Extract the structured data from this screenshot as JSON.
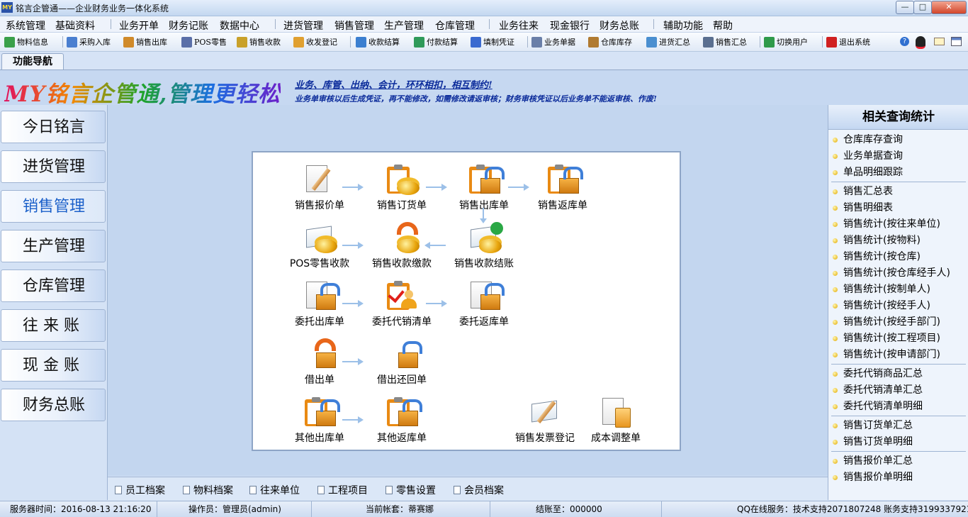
{
  "window": {
    "title": "铭言企管通——企业财务业务一体化系统",
    "logo_text": "MY",
    "controls": {
      "minimize": "—",
      "maximize": "□",
      "close": "✕"
    }
  },
  "menu": [
    "系统管理",
    "基础资料",
    "业务开单",
    "财务记账",
    "数据中心",
    "进货管理",
    "销售管理",
    "生产管理",
    "仓库管理",
    "业务往来",
    "现金银行",
    "财务总账",
    "辅助功能",
    "帮助"
  ],
  "toolbar": [
    {
      "label": "物料信息",
      "icon": "materials-icon",
      "color": "#3aa04a"
    },
    {
      "label": "采购入库",
      "icon": "purchase-in-icon",
      "color": "#4a7fd0"
    },
    {
      "label": "销售出库",
      "icon": "sales-out-icon",
      "color": "#d08a2a"
    },
    {
      "label": "POS零售",
      "icon": "pos-icon",
      "color": "#5a6fa8"
    },
    {
      "label": "销售收款",
      "icon": "sales-receipt-icon",
      "color": "#c9a12a"
    },
    {
      "label": "收发登记",
      "icon": "dispatch-register-icon",
      "color": "#e0a030"
    },
    {
      "label": "收款结算",
      "icon": "receipt-settle-icon",
      "color": "#3b7fd0"
    },
    {
      "label": "付款结算",
      "icon": "payment-settle-icon",
      "color": "#2f9a5a"
    },
    {
      "label": "填制凭证",
      "icon": "voucher-icon",
      "color": "#3a6ad0"
    },
    {
      "label": "业务单据",
      "icon": "documents-icon",
      "color": "#6a7fa8"
    },
    {
      "label": "仓库库存",
      "icon": "warehouse-icon",
      "color": "#b07a30"
    },
    {
      "label": "进货汇总",
      "icon": "purchase-summary-icon",
      "color": "#4a8fd0"
    },
    {
      "label": "销售汇总",
      "icon": "sales-summary-icon",
      "color": "#5a6f90"
    },
    {
      "label": "切换用户",
      "icon": "switch-user-icon",
      "color": "#2f9a4a"
    },
    {
      "label": "退出系统",
      "icon": "power-icon",
      "color": "#d02020"
    }
  ],
  "nav_tab": "功能导航",
  "banner": {
    "main": "MY铭言企管通,管理更轻松",
    "line1": "业务、库管、出纳、会计，环环相扣，相互制约!",
    "line2": "业务单审核以后生成凭证，再不能修改，如需修改请返审核；财务审核凭证以后业务单不能返审核、作废!"
  },
  "left_nav": [
    {
      "label": "今日铭言",
      "active": false
    },
    {
      "label": "进货管理",
      "active": false
    },
    {
      "label": "销售管理",
      "active": true
    },
    {
      "label": "生产管理",
      "active": false
    },
    {
      "label": "仓库管理",
      "active": false
    },
    {
      "label": "往 来 账",
      "active": false
    },
    {
      "label": "现 金 账",
      "active": false
    },
    {
      "label": "财务总账",
      "active": false
    }
  ],
  "flow": {
    "nodes": [
      {
        "id": "quote",
        "label": "销售报价单",
        "icon": "sales-quote-icon"
      },
      {
        "id": "order",
        "label": "销售订货单",
        "icon": "sales-order-icon"
      },
      {
        "id": "outbound",
        "label": "销售出库单",
        "icon": "sales-outbound-icon"
      },
      {
        "id": "return",
        "label": "销售返库单",
        "icon": "sales-return-icon"
      },
      {
        "id": "pos",
        "label": "POS零售收款",
        "icon": "pos-receipt-icon"
      },
      {
        "id": "payment",
        "label": "销售收款缴款",
        "icon": "sales-payment-icon"
      },
      {
        "id": "settle",
        "label": "销售收款结账",
        "icon": "sales-settle-icon"
      },
      {
        "id": "consign_out",
        "label": "委托出库单",
        "icon": "consign-out-icon"
      },
      {
        "id": "consign_list",
        "label": "委托代销清单",
        "icon": "consign-list-icon"
      },
      {
        "id": "consign_return",
        "label": "委托返库单",
        "icon": "consign-return-icon"
      },
      {
        "id": "lend",
        "label": "借出单",
        "icon": "lend-out-icon"
      },
      {
        "id": "lend_return",
        "label": "借出还回单",
        "icon": "lend-return-icon"
      },
      {
        "id": "other_out",
        "label": "其他出库单",
        "icon": "other-out-icon"
      },
      {
        "id": "other_return",
        "label": "其他返库单",
        "icon": "other-return-icon"
      },
      {
        "id": "invoice",
        "label": "销售发票登记",
        "icon": "invoice-register-icon"
      },
      {
        "id": "cost_adjust",
        "label": "成本调整单",
        "icon": "cost-adjust-icon"
      }
    ]
  },
  "right_panel": {
    "header": "相关查询统计",
    "groups": [
      [
        "仓库库存查询",
        "业务单据查询",
        "单品明细跟踪"
      ],
      [
        "销售汇总表",
        "销售明细表",
        "销售统计(按往来单位)",
        "销售统计(按物料)",
        "销售统计(按仓库)",
        "销售统计(按仓库经手人)",
        "销售统计(按制单人)",
        "销售统计(按经手人)",
        "销售统计(按经手部门)",
        "销售统计(按工程项目)",
        "销售统计(按申请部门)"
      ],
      [
        "委托代销商品汇总",
        "委托代销清单汇总",
        "委托代销清单明细"
      ],
      [
        "销售订货单汇总",
        "销售订货单明细"
      ],
      [
        "销售报价单汇总",
        "销售报价单明细"
      ]
    ]
  },
  "bottom_links": [
    "员工档案",
    "物料档案",
    "往来单位",
    "工程项目",
    "零售设置",
    "会员档案"
  ],
  "status": {
    "server_time": "服务器时间：2016-08-13 21:16:20",
    "operator": "操作员：管理员(admin)",
    "account": "当前帐套：蒂赛娜",
    "closing": "结账至：000000",
    "support": "QQ在线服务：技术支持2071807248  账务支持3199337921"
  },
  "colors": {
    "accent": "#1a5fc9",
    "arrow": "#9cc0e8",
    "banner_text": "#0a2a9a"
  }
}
